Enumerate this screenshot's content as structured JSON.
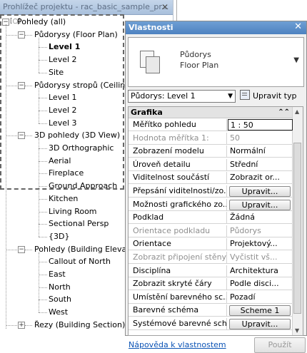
{
  "project_browser": {
    "title": "Prohlížeč projektu - rac_basic_sample_pr...",
    "close_label": "✕",
    "tree": [
      {
        "label": "Pohledy (all)",
        "level": 0,
        "expander": "−"
      },
      {
        "label": "Půdorysy (Floor Plan)",
        "level": 1,
        "expander": "−"
      },
      {
        "label": "Level 1",
        "level": 2,
        "bold": true
      },
      {
        "label": "Level 2",
        "level": 2
      },
      {
        "label": "Site",
        "level": 2
      },
      {
        "label": "Půdorysy stropů (Ceiling",
        "level": 1,
        "expander": "−"
      },
      {
        "label": "Level 1",
        "level": 2
      },
      {
        "label": "Level 2",
        "level": 2
      },
      {
        "label": "Level 3",
        "level": 2
      },
      {
        "label": "3D pohledy (3D View)",
        "level": 1,
        "expander": "−"
      },
      {
        "label": "3D Orthographic",
        "level": 2
      },
      {
        "label": "Aerial",
        "level": 2
      },
      {
        "label": "Fireplace",
        "level": 2
      },
      {
        "label": "Ground Approach",
        "level": 2
      },
      {
        "label": "Kitchen",
        "level": 2
      },
      {
        "label": "Living Room",
        "level": 2
      },
      {
        "label": "Sectional Persp",
        "level": 2
      },
      {
        "label": "{3D}",
        "level": 2
      },
      {
        "label": "Pohledy (Building Elevat",
        "level": 1,
        "expander": "−"
      },
      {
        "label": "Callout of North",
        "level": 2
      },
      {
        "label": "East",
        "level": 2
      },
      {
        "label": "North",
        "level": 2
      },
      {
        "label": "South",
        "level": 2
      },
      {
        "label": "West",
        "level": 2
      },
      {
        "label": "Řezy (Building Section)",
        "level": 1,
        "expander": "+"
      }
    ]
  },
  "properties": {
    "title": "Vlastnosti",
    "close_label": "✕",
    "type_selector": {
      "line1": "Půdorys",
      "line2": "Floor Plan",
      "dropdown": "▼"
    },
    "instance_filter": "Půdorys: Level 1",
    "edit_type_label": "Upravit typ",
    "group_label": "Grafika",
    "rows": [
      {
        "name": "Měřítko pohledu",
        "value": "1 : 50",
        "selected": true
      },
      {
        "name": "Hodnota měřítka   1:",
        "value": "50",
        "disabled": true
      },
      {
        "name": "Zobrazení modelu",
        "value": "Normální"
      },
      {
        "name": "Úroveň detailu",
        "value": "Střední"
      },
      {
        "name": "Viditelnost součástí",
        "value": "Zobrazit or..."
      },
      {
        "name": "Přepsání viditelnosti/zo...",
        "value": "Upravit...",
        "button": true
      },
      {
        "name": "Možnosti grafického zo...",
        "value": "Upravit...",
        "button": true
      },
      {
        "name": "Podklad",
        "value": "Žádná"
      },
      {
        "name": "Orientace podkladu",
        "value": "Půdorys",
        "disabled": true
      },
      {
        "name": "Orientace",
        "value": "Projektový..."
      },
      {
        "name": "Zobrazit připojení stěny",
        "value": "Vyčistit vš...",
        "disabled": true
      },
      {
        "name": "Disciplína",
        "value": "Architektura"
      },
      {
        "name": "Zobrazit skryté čáry",
        "value": "Podle disci..."
      },
      {
        "name": "Umístění barevného sc...",
        "value": "Pozadí"
      },
      {
        "name": "Barevné schéma",
        "value": "Scheme 1",
        "button": true
      },
      {
        "name": "Systémové barevné schéma",
        "value": "Upravit...",
        "button": true
      }
    ],
    "help_link": "Nápověda k vlastnostem",
    "apply_label": "Použít"
  }
}
